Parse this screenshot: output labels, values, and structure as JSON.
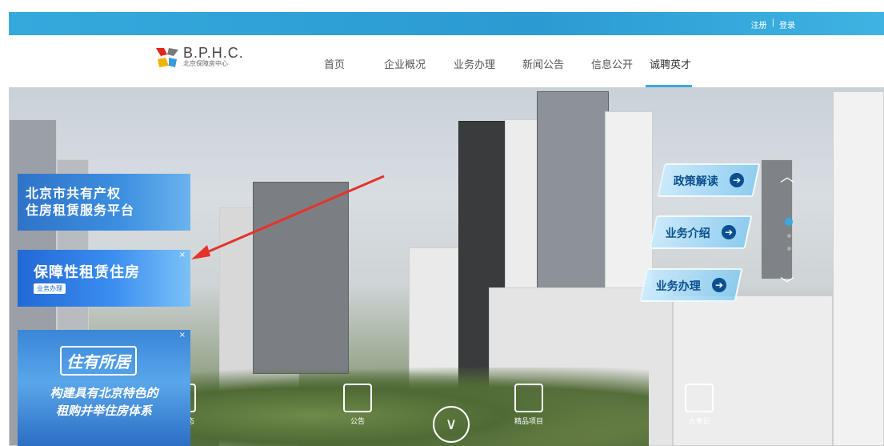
{
  "topbar": {
    "register": "注册",
    "separator": "|",
    "login": "登录"
  },
  "logo": {
    "title": "B.P.H.C.",
    "subtitle": "北京保障房中心"
  },
  "nav": {
    "items": [
      "首页",
      "企业概况",
      "业务办理",
      "新闻公告",
      "信息公开",
      "诚聘英才"
    ],
    "active": "诚聘英才"
  },
  "banners": {
    "b1": {
      "line1": "北京市共有产权",
      "line2": "住房租赁服务平台"
    },
    "b2": {
      "title": "保障性租赁住房",
      "tag": "业务办理",
      "close": "×"
    },
    "b3": {
      "title": "住有所居",
      "line1": "构建具有北京特色的",
      "line2": "租购并举住房体系",
      "close": "×"
    }
  },
  "side_buttons": [
    {
      "label": "政策解读",
      "arrow": "➔"
    },
    {
      "label": "业务介绍",
      "arrow": "➔"
    },
    {
      "label": "业务办理",
      "arrow": "➔"
    }
  ],
  "bottom_icons": {
    "announce": "公告",
    "projects": "精品项目",
    "events": "大事记",
    "news": "动态"
  },
  "colors": {
    "accent": "#38aadf",
    "topbar": "#2b9ad2",
    "annotation_arrow": "#e5332a"
  }
}
